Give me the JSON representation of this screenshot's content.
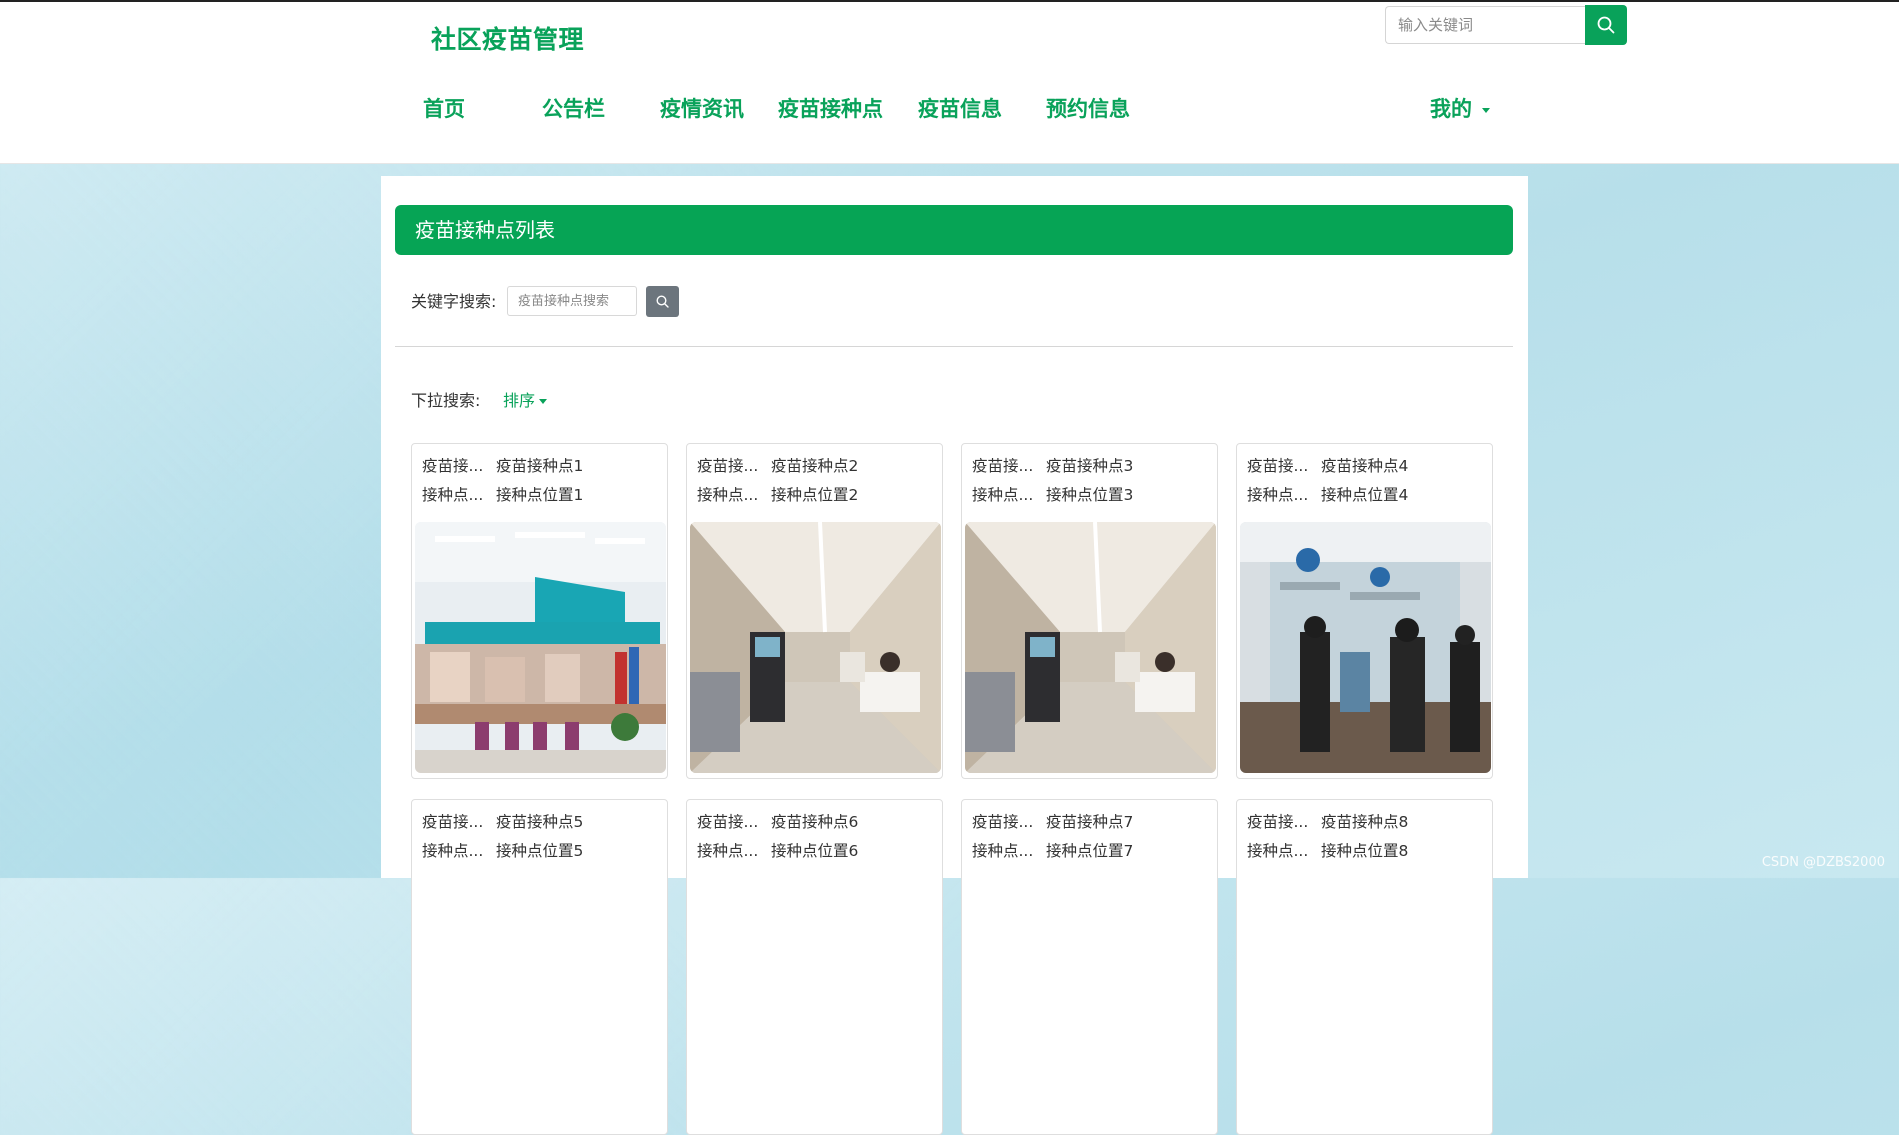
{
  "header": {
    "logo": "社区疫苗管理",
    "search_placeholder": "输入关键词",
    "nav": [
      "首页",
      "公告栏",
      "疫情资讯",
      "疫苗接种点",
      "疫苗信息",
      "预约信息"
    ],
    "account_menu": "我的"
  },
  "panel": {
    "title": "疫苗接种点列表",
    "keyword_label": "关键字搜索:",
    "keyword_placeholder": "疫苗接种点搜索",
    "dropdown_label": "下拉搜索:",
    "sort_label": "排序"
  },
  "cards": [
    {
      "name_label": "疫苗接...",
      "name": "疫苗接种点1",
      "loc_label": "接种点...",
      "location": "接种点位置1"
    },
    {
      "name_label": "疫苗接...",
      "name": "疫苗接种点2",
      "loc_label": "接种点...",
      "location": "接种点位置2"
    },
    {
      "name_label": "疫苗接...",
      "name": "疫苗接种点3",
      "loc_label": "接种点...",
      "location": "接种点位置3"
    },
    {
      "name_label": "疫苗接...",
      "name": "疫苗接种点4",
      "loc_label": "接种点...",
      "location": "接种点位置4"
    },
    {
      "name_label": "疫苗接...",
      "name": "疫苗接种点5",
      "loc_label": "接种点...",
      "location": "接种点位置5"
    },
    {
      "name_label": "疫苗接...",
      "name": "疫苗接种点6",
      "loc_label": "接种点...",
      "location": "接种点位置6"
    },
    {
      "name_label": "疫苗接...",
      "name": "疫苗接种点7",
      "loc_label": "接种点...",
      "location": "接种点位置7"
    },
    {
      "name_label": "疫苗接...",
      "name": "疫苗接种点8",
      "loc_label": "接种点...",
      "location": "接种点位置8"
    }
  ],
  "watermark": "CSDN @DZBS2000",
  "colors": {
    "brand": "#09a25a",
    "title_bar": "#06a455",
    "search_btn_gray": "#6c757d"
  }
}
